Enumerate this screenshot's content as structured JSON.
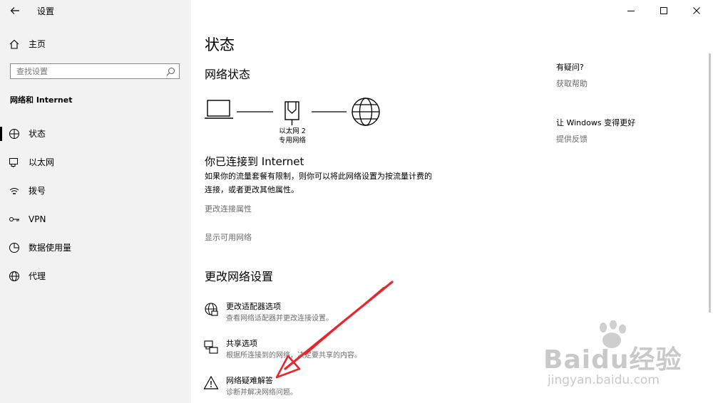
{
  "window": {
    "back_icon": "back-arrow-icon",
    "title": "设置",
    "controls": [
      "minimize-icon",
      "maximize-icon",
      "close-icon"
    ]
  },
  "sidebar": {
    "home_label": "主页",
    "search_placeholder": "查找设置",
    "section_title": "网络和 Internet",
    "items": [
      {
        "label": "状态",
        "icon": "status-icon",
        "selected": true
      },
      {
        "label": "以太网",
        "icon": "ethernet-icon",
        "selected": false
      },
      {
        "label": "拨号",
        "icon": "dialup-icon",
        "selected": false
      },
      {
        "label": "VPN",
        "icon": "vpn-icon",
        "selected": false
      },
      {
        "label": "数据使用量",
        "icon": "data-usage-icon",
        "selected": false
      },
      {
        "label": "代理",
        "icon": "proxy-icon",
        "selected": false
      }
    ]
  },
  "main": {
    "page_title": "状态",
    "network_status_heading": "网络状态",
    "diagram": {
      "adapter_name": "以太网 2",
      "network_type": "专用网络"
    },
    "connected_heading": "你已连接到 Internet",
    "connected_desc_line1": "如果你的流量套餐有限制，则你可以将此网络设置为按流量计费的",
    "connected_desc_line2": "连接，或者更改其他属性。",
    "link_change_props": "更改连接属性",
    "link_show_networks": "显示可用网络",
    "change_settings_heading": "更改网络设置",
    "options": [
      {
        "title": "更改适配器选项",
        "desc": "查看网络适配器并更改连接设置。",
        "icon": "adapter-icon"
      },
      {
        "title": "共享选项",
        "desc": "根据所连接到的网络，决定要共享的内容。",
        "icon": "sharing-icon"
      },
      {
        "title": "网络疑难解答",
        "desc": "诊断并解决网络问题。",
        "icon": "warning-icon"
      }
    ]
  },
  "right_panel": {
    "help_heading": "有疑问?",
    "help_link": "获取帮助",
    "feedback_heading": "让 Windows 变得更好",
    "feedback_link": "提供反馈"
  },
  "watermark": {
    "brand": "Baidu经验",
    "url": "jingyan.baidu.com"
  },
  "colors": {
    "sidebar_bg": "#f2f2f2",
    "annotation_arrow": "#e8262b"
  }
}
